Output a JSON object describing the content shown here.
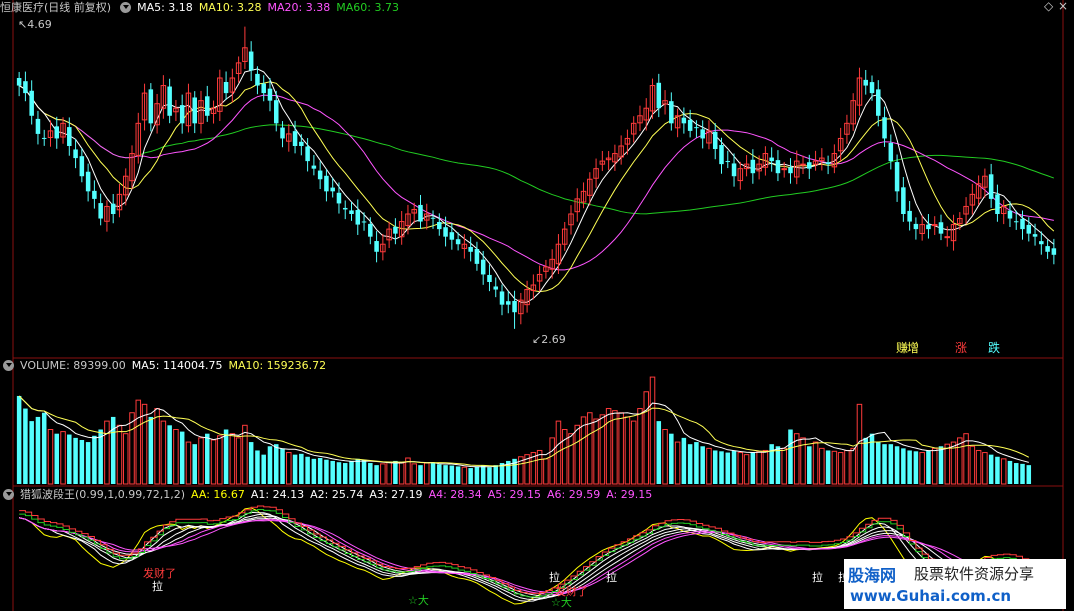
{
  "colors": {
    "up": "#ff3b3b",
    "down": "#54ffff",
    "ma5": "#ffffff",
    "ma10": "#ffff55",
    "ma20": "#ff55ff",
    "ma60": "#22cc22",
    "text": "#c8c8c8",
    "grid": "#8a1010",
    "aa": "#ffff00",
    "a_lines": "#ff55ff"
  },
  "price_panel": {
    "name": "恒康医疗(日线 前复权)",
    "ma5": "MA5: 3.18",
    "ma10": "MA10: 3.28",
    "ma20": "MA20: 3.38",
    "ma60": "MA60: 3.73",
    "high_label": "4.69",
    "low_label": "2.69",
    "legend": [
      "赚",
      "增",
      "涨",
      "跌"
    ]
  },
  "volume_panel": {
    "volume": "VOLUME: 89399.00",
    "ma5": "MA5: 114004.75",
    "ma10": "MA10: 159236.72"
  },
  "indicator_panel": {
    "name": "猎狐波段王(0.99,1,0.99,72,1,2)",
    "aa": "AA: 16.67",
    "a1": "A1: 24.13",
    "a2": "A2: 25.74",
    "a3": "A3: 27.19",
    "a4": "A4: 28.34",
    "a5": "A5: 29.15",
    "a6": "A6: 29.59",
    "a": "A: 29.15",
    "signals": [
      "发财了",
      "拉",
      "☆大",
      "发财了",
      "☆大",
      "拉",
      "拉",
      "拉",
      "拉"
    ]
  },
  "watermark": {
    "brand": "股海网",
    "slogan": "股票软件资源分享",
    "url": "www.Guhai.com.cn"
  },
  "chart_data": {
    "type": "candlestick",
    "ylim": [
      2.55,
      4.8
    ],
    "highest": 4.69,
    "lowest": 2.69,
    "closes": [
      4.3,
      4.25,
      4.1,
      3.98,
      3.95,
      4.0,
      3.95,
      4.05,
      3.9,
      3.82,
      3.7,
      3.6,
      3.55,
      3.42,
      3.5,
      3.45,
      3.58,
      3.7,
      3.85,
      4.05,
      4.25,
      4.05,
      4.18,
      4.3,
      4.1,
      4.15,
      4.05,
      4.25,
      4.05,
      4.2,
      4.1,
      4.15,
      4.35,
      4.25,
      4.35,
      4.45,
      4.55,
      4.4,
      4.3,
      4.25,
      4.2,
      4.05,
      3.95,
      3.98,
      3.9,
      3.9,
      3.8,
      3.75,
      3.68,
      3.6,
      3.6,
      3.52,
      3.48,
      3.45,
      3.38,
      3.4,
      3.3,
      3.2,
      3.25,
      3.35,
      3.32,
      3.4,
      3.45,
      3.48,
      3.4,
      3.45,
      3.42,
      3.35,
      3.3,
      3.28,
      3.25,
      3.25,
      3.2,
      3.12,
      3.05,
      3.0,
      2.95,
      2.85,
      2.85,
      2.8,
      2.88,
      2.95,
      2.98,
      3.05,
      3.1,
      3.15,
      3.25,
      3.35,
      3.45,
      3.55,
      3.6,
      3.68,
      3.75,
      3.8,
      3.82,
      3.85,
      3.9,
      3.95,
      4.05,
      4.1,
      4.15,
      4.3,
      4.15,
      4.2,
      4.05,
      4.1,
      4.05,
      4.0,
      4.02,
      3.95,
      4.0,
      3.88,
      3.78,
      3.8,
      3.7,
      3.75,
      3.78,
      3.72,
      3.78,
      3.85,
      3.8,
      3.72,
      3.75,
      3.72,
      3.8,
      3.78,
      3.75,
      3.8,
      3.82,
      3.78,
      3.85,
      3.95,
      4.05,
      4.2,
      4.35,
      4.3,
      4.25,
      4.1,
      3.95,
      3.8,
      3.6,
      3.45,
      3.4,
      3.35,
      3.38,
      3.35,
      3.38,
      3.32,
      3.3,
      3.38,
      3.42,
      3.5,
      3.58,
      3.65,
      3.7,
      3.55,
      3.45,
      3.5,
      3.42,
      3.4,
      3.35,
      3.32,
      3.3,
      3.25,
      3.2,
      3.18
    ],
    "volume_ylim": [
      0,
      260000
    ],
    "volumes": [
      210000,
      180000,
      150000,
      160000,
      170000,
      130000,
      120000,
      125000,
      118000,
      110000,
      105000,
      100000,
      115000,
      130000,
      150000,
      160000,
      140000,
      120000,
      170000,
      200000,
      190000,
      160000,
      180000,
      150000,
      140000,
      130000,
      125000,
      100000,
      95000,
      110000,
      120000,
      105000,
      115000,
      130000,
      120000,
      110000,
      140000,
      100000,
      80000,
      70000,
      90000,
      95000,
      85000,
      75000,
      70000,
      72000,
      65000,
      60000,
      62000,
      58000,
      55000,
      52000,
      50000,
      55000,
      60000,
      58000,
      50000,
      45000,
      48000,
      52000,
      55000,
      50000,
      62000,
      48000,
      45000,
      50000,
      52000,
      47000,
      45000,
      44000,
      42000,
      40000,
      38000,
      42000,
      45000,
      40000,
      45000,
      50000,
      55000,
      60000,
      65000,
      70000,
      75000,
      80000,
      60000,
      110000,
      150000,
      130000,
      120000,
      140000,
      160000,
      170000,
      155000,
      165000,
      180000,
      175000,
      170000,
      160000,
      150000,
      180000,
      220000,
      255000,
      150000,
      130000,
      120000,
      100000,
      110000,
      95000,
      100000,
      90000,
      85000,
      80000,
      78000,
      75000,
      80000,
      75000,
      70000,
      75000,
      78000,
      80000,
      95000,
      90000,
      85000,
      130000,
      120000,
      110000,
      90000,
      100000,
      85000,
      80000,
      78000,
      75000,
      80000,
      85000,
      190000,
      110000,
      120000,
      100000,
      95000,
      95000,
      90000,
      85000,
      80000,
      78000,
      75000,
      80000,
      85000,
      90000,
      95000,
      100000,
      110000,
      120000,
      90000,
      80000,
      75000,
      70000,
      65000,
      60000,
      55000,
      50000,
      48000,
      45000
    ]
  }
}
